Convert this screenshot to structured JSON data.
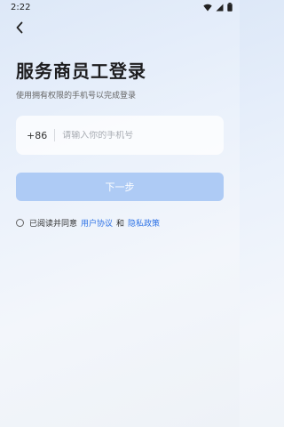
{
  "status_bar": {
    "time": "2:22"
  },
  "header": {
    "title": "服务商员工登录",
    "subtitle": "使用拥有权限的手机号以完成登录"
  },
  "phone": {
    "country_code": "+86",
    "placeholder": "请输入你的手机号"
  },
  "next_button": {
    "label": "下一步"
  },
  "agreement": {
    "prefix": "已阅读并同意",
    "user_agreement": "用户协议",
    "conjunction": "和",
    "privacy_policy": "隐私政策"
  },
  "colors": {
    "accent": "#2f73e6",
    "button_disabled": "#aecbf5"
  }
}
